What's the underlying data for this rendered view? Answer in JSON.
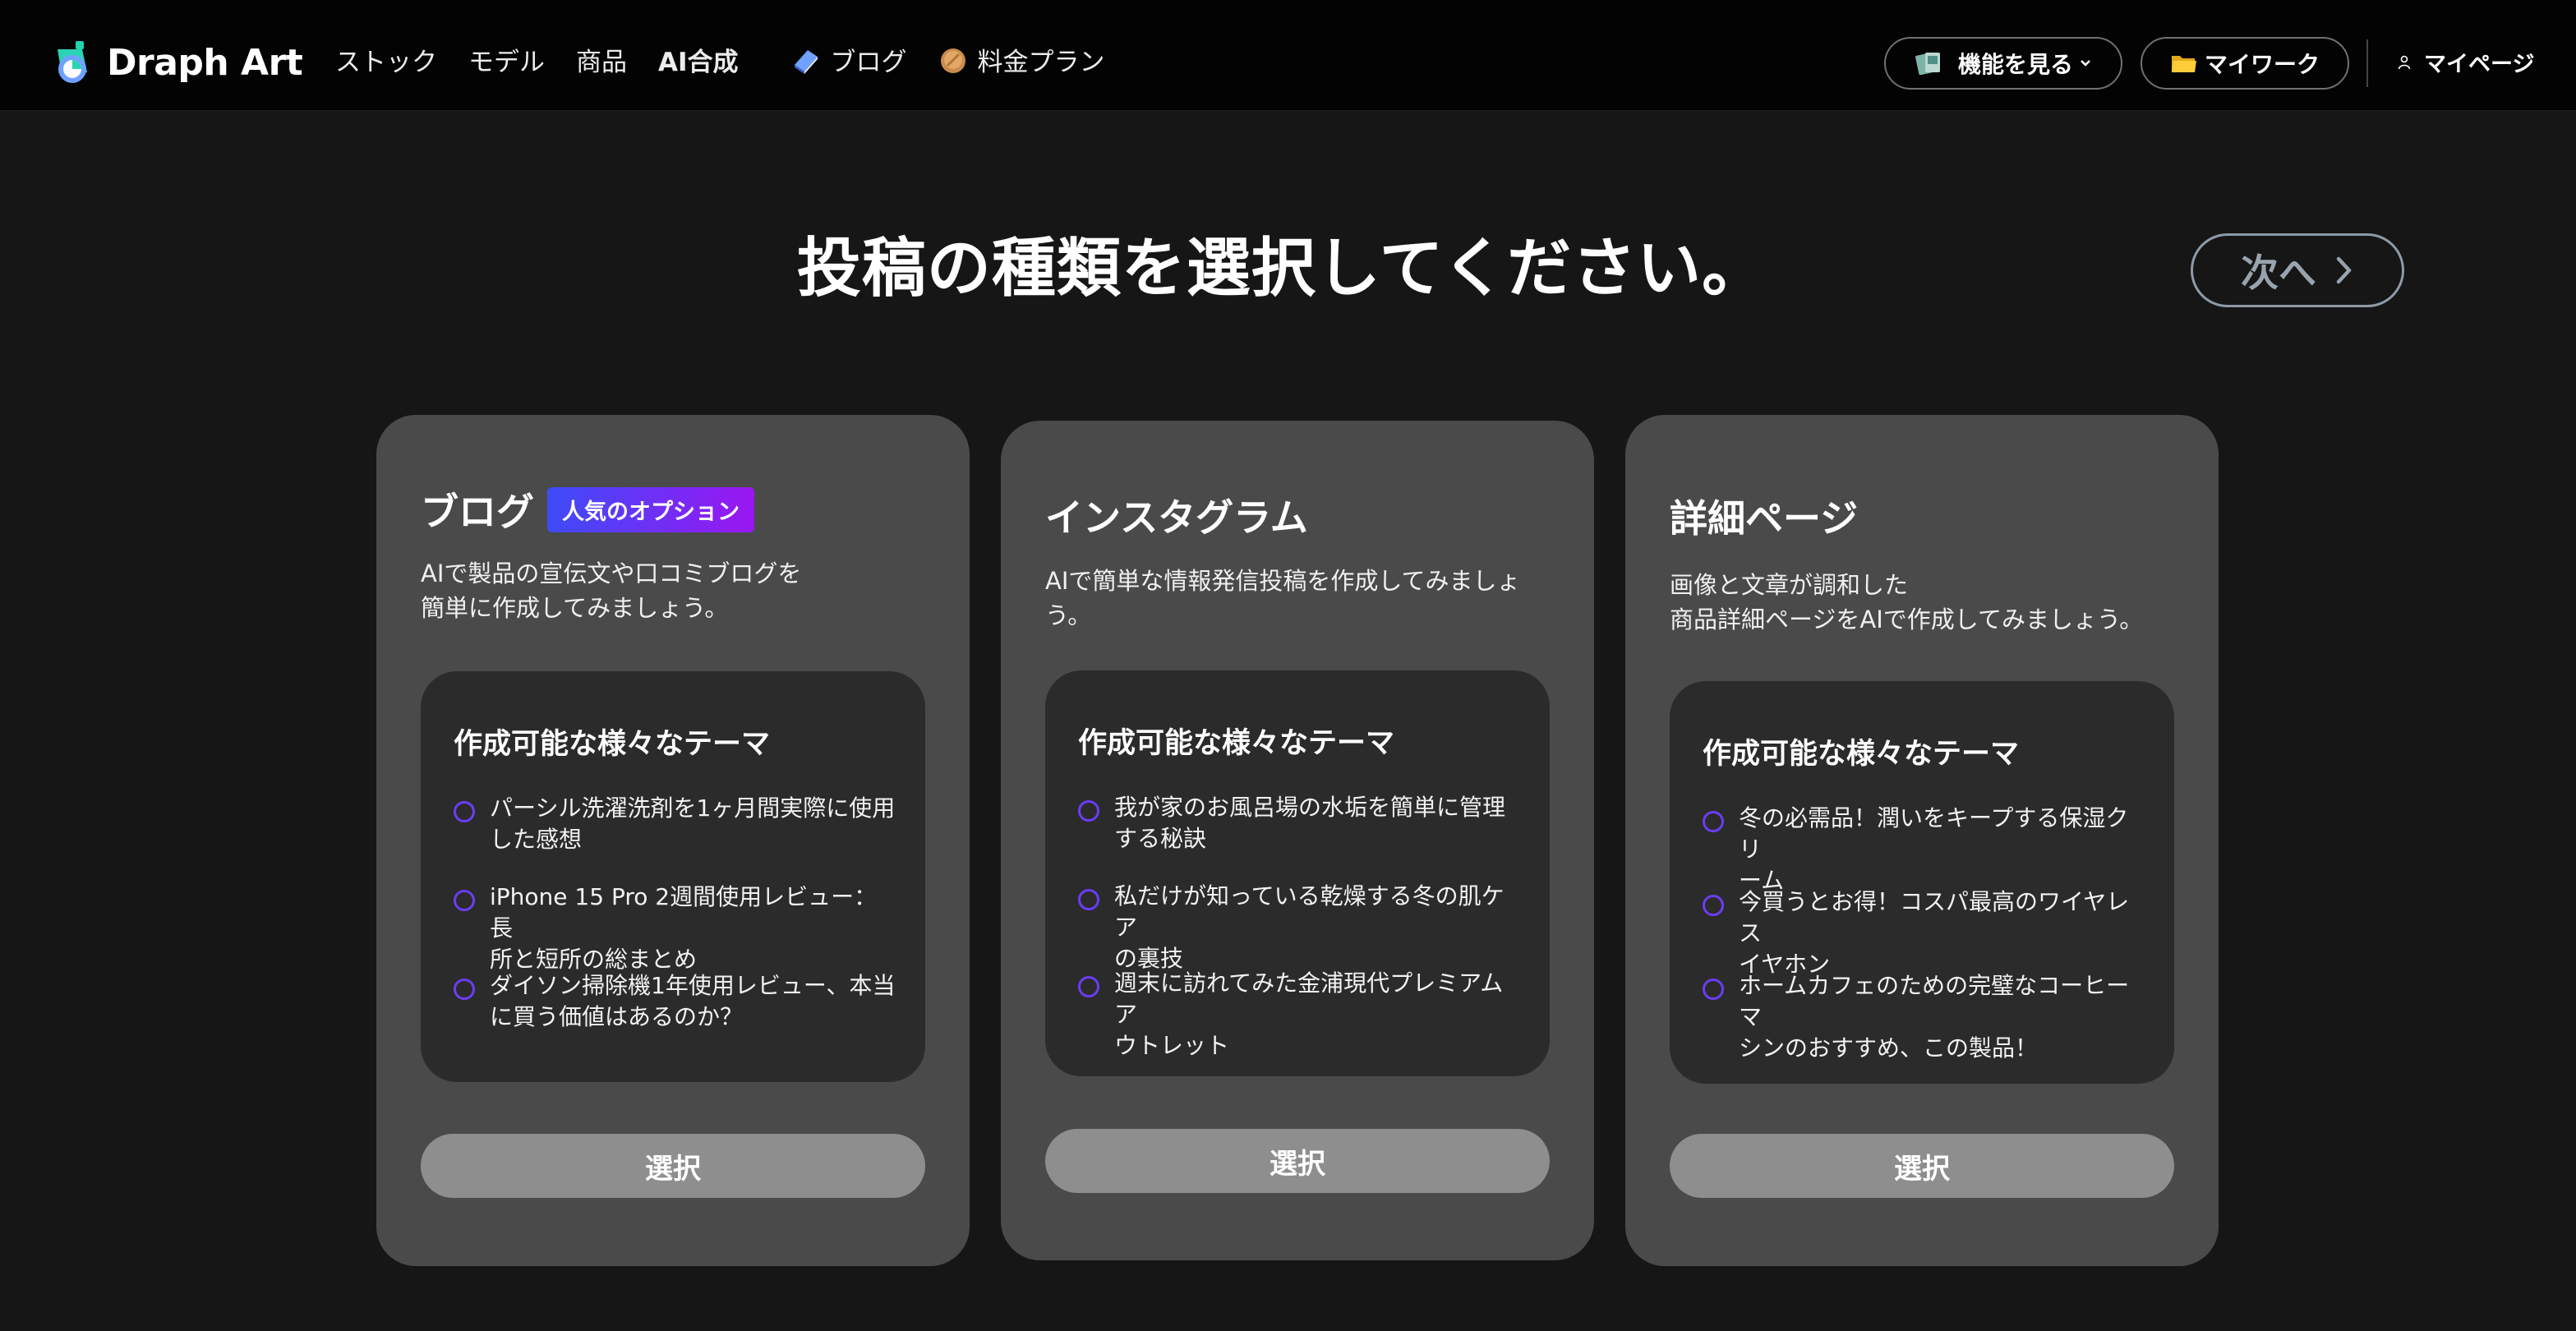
{
  "header": {
    "logo_text": "Draph Art",
    "nav": [
      {
        "label": "ストック"
      },
      {
        "label": "モデル"
      },
      {
        "label": "商品"
      },
      {
        "label": "AI合成"
      },
      {
        "label": "ブログ",
        "icon": "book-icon"
      },
      {
        "label": "料金プラン",
        "icon": "coin-icon"
      }
    ],
    "features_label": "機能を見る",
    "mywork_label": "マイワーク",
    "mypage_label": "マイページ"
  },
  "main": {
    "title": "投稿の種類を選択してください。",
    "next_label": "次へ"
  },
  "cards": [
    {
      "title": "ブログ",
      "badge": "人気のオプション",
      "desc_lines": [
        "AIで製品の宣伝文や口コミブログを",
        "簡単に作成してみましょう。"
      ],
      "themes_title": "作成可能な様々なテーマ",
      "themes": [
        [
          "パーシル洗濯洗剤を1ヶ月間実際に使用",
          "した感想"
        ],
        [
          "iPhone 15 Pro 2週間使用レビュー：長",
          "所と短所の総まとめ"
        ],
        [
          "ダイソン掃除機1年使用レビュー、本当",
          "に買う価値はあるのか？"
        ]
      ],
      "select_label": "選択"
    },
    {
      "title": "インスタグラム",
      "desc_lines": [
        "AIで簡単な情報発信投稿を作成してみましょ",
        "う。"
      ],
      "themes_title": "作成可能な様々なテーマ",
      "themes": [
        [
          "我が家のお風呂場の水垢を簡単に管理",
          "する秘訣"
        ],
        [
          "私だけが知っている乾燥する冬の肌ケア",
          "の裏技"
        ],
        [
          "週末に訪れてみた金浦現代プレミアムア",
          "ウトレット"
        ]
      ],
      "select_label": "選択"
    },
    {
      "title": "詳細ページ",
      "desc_lines": [
        "画像と文章が調和した",
        "商品詳細ページをAIで作成してみましょう。"
      ],
      "themes_title": "作成可能な様々なテーマ",
      "themes": [
        [
          "冬の必需品！潤いをキープする保湿クリ",
          "ーム"
        ],
        [
          "今買うとお得！コスパ最高のワイヤレス",
          "イヤホン"
        ],
        [
          "ホームカフェのための完璧なコーヒーマ",
          "シンのおすすめ、この製品！"
        ]
      ],
      "select_label": "選択"
    }
  ],
  "colors": {
    "background": "#161616",
    "header": "#030303",
    "card": "#4a4a4a",
    "theme_box": "#2b2b2b",
    "radio": "#6a3df5",
    "badge_start": "#3d4cf7",
    "badge_end": "#9b16f2",
    "select_button": "#8e8e8e"
  }
}
